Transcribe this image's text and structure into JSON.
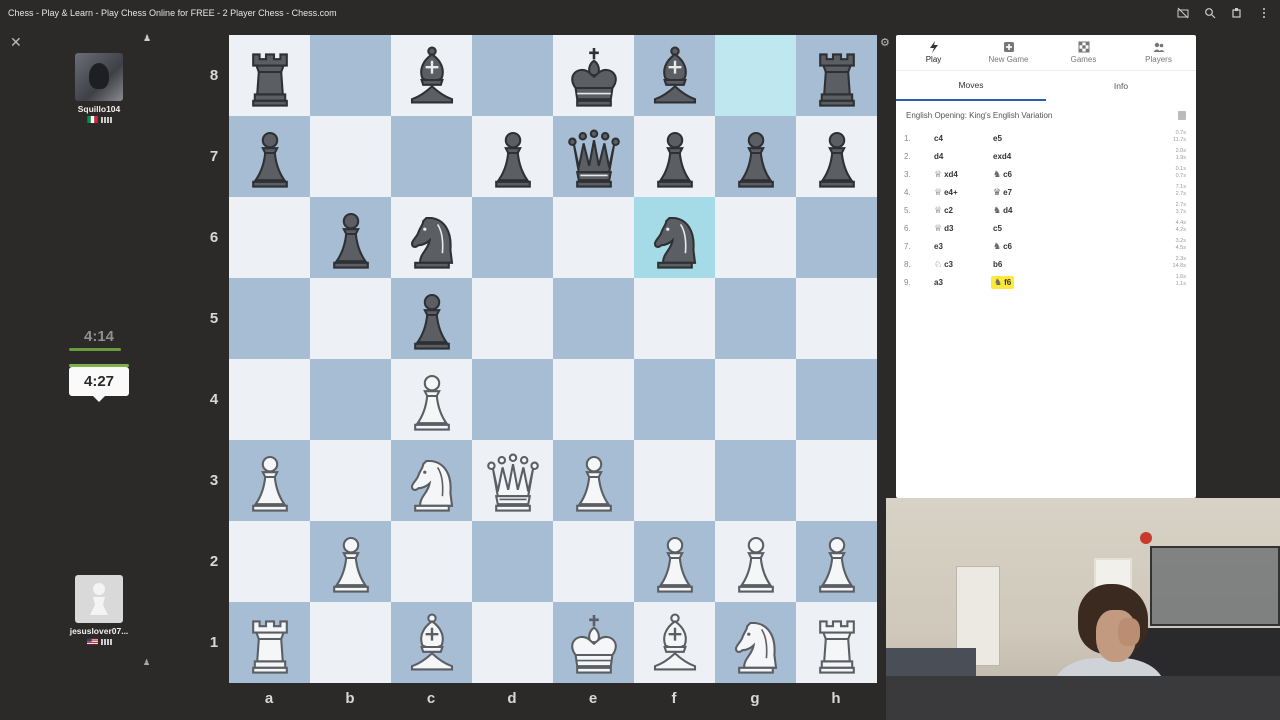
{
  "window": {
    "title": "Chess - Play & Learn - Play Chess Online for FREE - 2 Player Chess - Chess.com"
  },
  "top_player": {
    "name": "Squillo104",
    "flag_colors": [
      "#009246",
      "#ffffff",
      "#ce2b37"
    ],
    "clock": "4:14"
  },
  "bottom_player": {
    "name": "jesuslover07...",
    "clock": "4:27"
  },
  "board": {
    "ranks": [
      "8",
      "7",
      "6",
      "5",
      "4",
      "3",
      "2",
      "1"
    ],
    "files": [
      "a",
      "b",
      "c",
      "d",
      "e",
      "f",
      "g",
      "h"
    ],
    "light_color": "#edf1f5",
    "dark_color": "#a7bdd3",
    "highlight_color": "#bfe7f0",
    "position": [
      [
        "bR",
        "",
        "bB",
        "",
        "bK",
        "bB",
        "",
        "bR"
      ],
      [
        "bP",
        "",
        "",
        "bP",
        "bQ",
        "bP",
        "bP",
        "bP"
      ],
      [
        "",
        "bP",
        "bN",
        "",
        "",
        "bN",
        "",
        ""
      ],
      [
        "",
        "",
        "bP",
        "",
        "",
        "",
        "",
        ""
      ],
      [
        "",
        "",
        "wP",
        "",
        "",
        "",
        "",
        ""
      ],
      [
        "wP",
        "",
        "wN",
        "wQ",
        "wP",
        "",
        "",
        ""
      ],
      [
        "",
        "wP",
        "",
        "",
        "",
        "wP",
        "wP",
        "wP"
      ],
      [
        "wR",
        "",
        "wB",
        "",
        "wK",
        "wB",
        "wN",
        "wR"
      ]
    ],
    "highlighted_squares": [
      "g8",
      "f6"
    ]
  },
  "panel": {
    "tabs": [
      {
        "label": "Play",
        "icon": "bolt-icon"
      },
      {
        "label": "New Game",
        "icon": "plus-icon"
      },
      {
        "label": "Games",
        "icon": "board-icon"
      },
      {
        "label": "Players",
        "icon": "players-icon"
      }
    ],
    "subtabs": [
      "Moves",
      "Info"
    ],
    "opening": "English Opening: King's English Variation",
    "moves": [
      {
        "num": "1.",
        "white": "c4",
        "white_piece": "",
        "black": "e5",
        "black_piece": "",
        "t1": "0.7s",
        "t2": "11.7s"
      },
      {
        "num": "2.",
        "white": "d4",
        "white_piece": "",
        "black": "exd4",
        "black_piece": "",
        "t1": "2.0s",
        "t2": "1.9s"
      },
      {
        "num": "3.",
        "white": "xd4",
        "white_piece": "♕",
        "black": "c6",
        "black_piece": "♞",
        "t1": "0.1s",
        "t2": "0.7s"
      },
      {
        "num": "4.",
        "white": "e4+",
        "white_piece": "♕",
        "black": "e7",
        "black_piece": "♛",
        "t1": "7.1s",
        "t2": "2.7s"
      },
      {
        "num": "5.",
        "white": "c2",
        "white_piece": "♕",
        "black": "d4",
        "black_piece": "♞",
        "t1": "2.7s",
        "t2": "3.7s"
      },
      {
        "num": "6.",
        "white": "d3",
        "white_piece": "♕",
        "black": "c5",
        "black_piece": "",
        "t1": "4.4s",
        "t2": "4.2s"
      },
      {
        "num": "7.",
        "white": "e3",
        "white_piece": "",
        "black": "c6",
        "black_piece": "♞",
        "t1": "3.2s",
        "t2": "4.5s"
      },
      {
        "num": "8.",
        "white": "c3",
        "white_piece": "♘",
        "black": "b6",
        "black_piece": "",
        "t1": "2.3s",
        "t2": "14.8s"
      },
      {
        "num": "9.",
        "white": "a3",
        "white_piece": "",
        "black": "f6",
        "black_piece": "♞",
        "t1": "1.6s",
        "t2": "1.1s"
      }
    ]
  }
}
